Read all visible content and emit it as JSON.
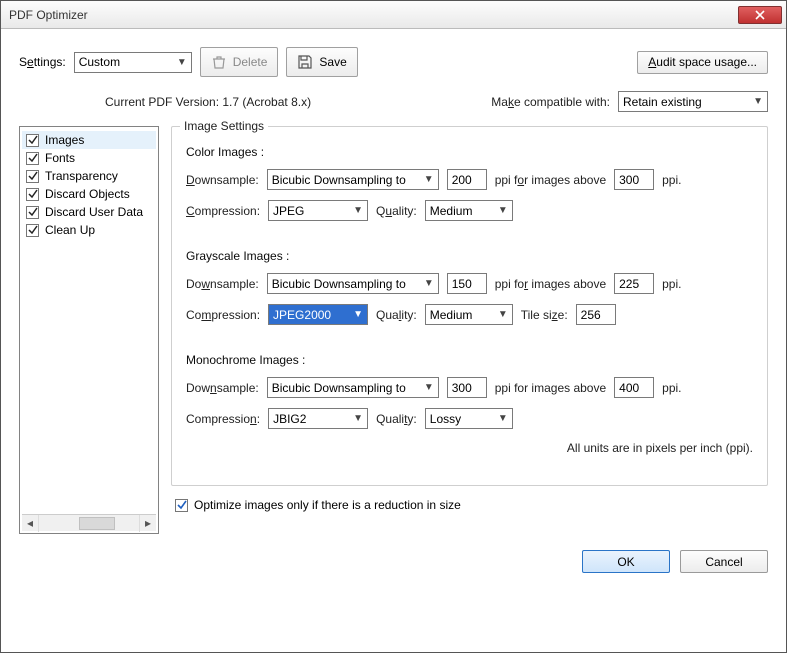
{
  "window": {
    "title": "PDF Optimizer"
  },
  "toolbar": {
    "settings_label": "Settings:",
    "settings_value": "Custom",
    "delete_label": " Delete",
    "save_label": " Save",
    "audit_label": "Audit space usage..."
  },
  "meta": {
    "version_text": "Current PDF Version: 1.7 (Acrobat 8.x)",
    "compat_label": "Make compatible with:",
    "compat_value": "Retain existing"
  },
  "sidebar": {
    "items": [
      {
        "label": "Images",
        "checked": true,
        "selected": true
      },
      {
        "label": "Fonts",
        "checked": true
      },
      {
        "label": "Transparency",
        "checked": true
      },
      {
        "label": "Discard Objects",
        "checked": true
      },
      {
        "label": "Discard User Data",
        "checked": true
      },
      {
        "label": "Clean Up",
        "checked": true
      }
    ]
  },
  "panel": {
    "legend": "Image Settings",
    "color": {
      "heading": "Color Images :",
      "downsample_label_pre": "D",
      "downsample_label": "ownsample:",
      "downsample_value": "Bicubic Downsampling to",
      "ppi": "200",
      "above_label_pre": "ppi f",
      "above_u": "o",
      "above_label_post": "r images above",
      "above_ppi": "300",
      "ppi_suffix": "ppi.",
      "compression_u": "C",
      "compression_label": "ompression:",
      "compression_value": "JPEG",
      "quality_label_pre": "Q",
      "quality_u": "u",
      "quality_label_post": "ality:",
      "quality_value": "Medium"
    },
    "gray": {
      "heading": "Grayscale Images :",
      "downsample_label_pre": "Do",
      "downsample_u": "w",
      "downsample_label_post": "nsample:",
      "downsample_value": "Bicubic Downsampling to",
      "ppi": "150",
      "above_label_pre": "ppi fo",
      "above_u": "r",
      "above_label_post": " images above",
      "above_ppi": "225",
      "ppi_suffix": "ppi.",
      "compression_label_pre": "Co",
      "compression_u": "m",
      "compression_label_post": "pression:",
      "compression_value": "JPEG2000",
      "quality_label_pre": "Qua",
      "quality_u": "l",
      "quality_label_post": "ity:",
      "quality_value": "Medium",
      "tile_label_pre": "Tile si",
      "tile_u": "z",
      "tile_label_post": "e:",
      "tile_value": "256"
    },
    "mono": {
      "heading": "Monochrome Images :",
      "downsample_label_pre": "Dow",
      "downsample_u": "n",
      "downsample_label_post": "sample:",
      "downsample_value": "Bicubic Downsampling to",
      "ppi": "300",
      "above_label_pre": "ppi for ima",
      "above_u": "g",
      "above_label_post": "es above",
      "above_ppi": "400",
      "ppi_suffix": "ppi.",
      "compression_label_pre": "Compressio",
      "compression_u": "n",
      "compression_label_post": ":",
      "compression_value": "JBIG2",
      "quality_label_pre": "Quali",
      "quality_u": "t",
      "quality_label_post": "y:",
      "quality_value": "Lossy"
    },
    "units_note": "All units are in pixels per inch (ppi).",
    "optimize_checkbox": "Optimize images only if there is a reduction in size"
  },
  "footer": {
    "ok": "OK",
    "cancel": "Cancel"
  }
}
